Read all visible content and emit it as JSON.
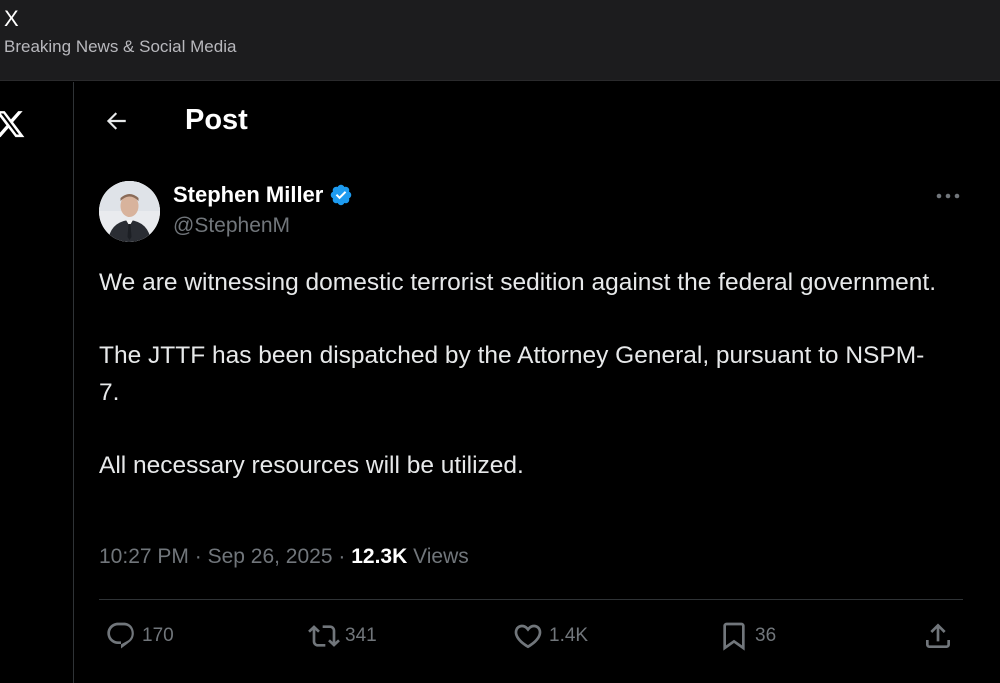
{
  "window": {
    "app_name": "X",
    "subtitle": "Breaking News & Social Media"
  },
  "icons": {
    "logo": "x-logo-icon",
    "back": "arrow-left-icon",
    "verified": "verified-badge-icon",
    "more": "more-horizontal-icon",
    "reply": "reply-icon",
    "repost": "repost-icon",
    "like": "heart-icon",
    "bookmark": "bookmark-icon",
    "share": "share-icon"
  },
  "header": {
    "title": "Post"
  },
  "author": {
    "display_name": "Stephen Miller",
    "handle": "@StephenM",
    "verified": true
  },
  "tweet": {
    "paragraphs": [
      "We are witnessing domestic terrorist sedition against the federal government.",
      "The JTTF has been dispatched by the Attorney General, pursuant to NSPM-7.",
      "All necessary resources will be utilized."
    ],
    "time": "10:27 PM",
    "date": "Sep 26, 2025",
    "views_count": "12.3K",
    "views_label": "Views",
    "separator": "·"
  },
  "actions": {
    "replies": "170",
    "reposts": "341",
    "likes": "1.4K",
    "bookmarks": "36"
  },
  "colors": {
    "background": "#000000",
    "text": "#e7e9ea",
    "secondary": "#71767b",
    "verified": "#1d9bf0",
    "divider": "#2f3336"
  }
}
